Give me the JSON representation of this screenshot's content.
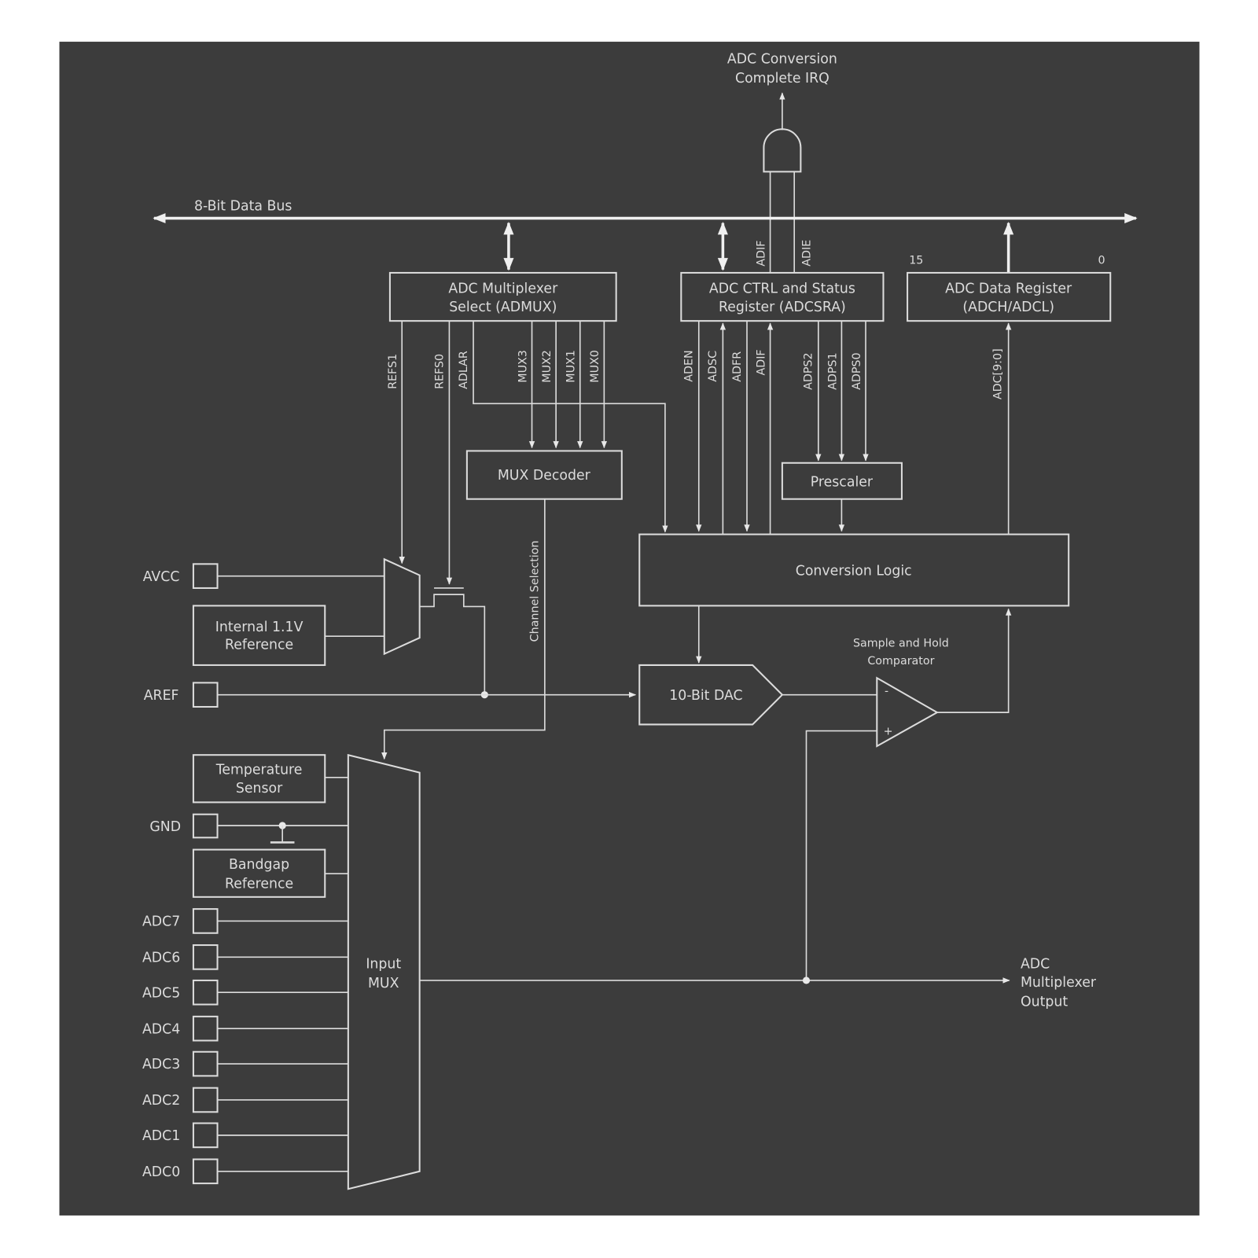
{
  "colors": {
    "background": "#3c3c3c",
    "line": "#dcdcdc",
    "page": "#ffffff"
  },
  "irq": {
    "line1": "ADC Conversion",
    "line2": "Complete IRQ"
  },
  "bus": {
    "label": "8-Bit Data Bus"
  },
  "admux": {
    "line1": "ADC Multiplexer",
    "line2": "Select (ADMUX)",
    "bits": [
      "REFS1",
      "REFS0",
      "ADLAR",
      "MUX3",
      "MUX2",
      "MUX1",
      "MUX0"
    ]
  },
  "adcsra": {
    "line1": "ADC CTRL and Status",
    "line2": "Register (ADCSRA)",
    "bits": [
      "ADEN",
      "ADSC",
      "ADFR",
      "ADIF",
      "ADPS2",
      "ADPS1",
      "ADPS0"
    ],
    "irq_bits": [
      "ADIF",
      "ADIE"
    ]
  },
  "datareg": {
    "line1": "ADC Data Register",
    "line2": "(ADCH/ADCL)",
    "msb": "15",
    "lsb": "0",
    "bus_label": "ADC[9:0]"
  },
  "mux_decoder": "MUX Decoder",
  "channel_selection": "Channel Selection",
  "prescaler": "Prescaler",
  "conversion_logic": "Conversion Logic",
  "dac": "10-Bit DAC",
  "comparator": {
    "line1": "Sample and Hold",
    "line2": "Comparator",
    "minus": "-",
    "plus": "+"
  },
  "internal_ref": {
    "line1": "Internal 1.1V",
    "line2": "Reference"
  },
  "temp_sensor": {
    "line1": "Temperature",
    "line2": "Sensor"
  },
  "bandgap": {
    "line1": "Bandgap",
    "line2": "Reference"
  },
  "input_mux": {
    "line1": "Input",
    "line2": "MUX"
  },
  "output": {
    "line1": "ADC",
    "line2": "Multiplexer",
    "line3": "Output"
  },
  "pins": {
    "avcc": "AVCC",
    "aref": "AREF",
    "gnd": "GND",
    "adc": [
      "ADC7",
      "ADC6",
      "ADC5",
      "ADC4",
      "ADC3",
      "ADC2",
      "ADC1",
      "ADC0"
    ]
  }
}
